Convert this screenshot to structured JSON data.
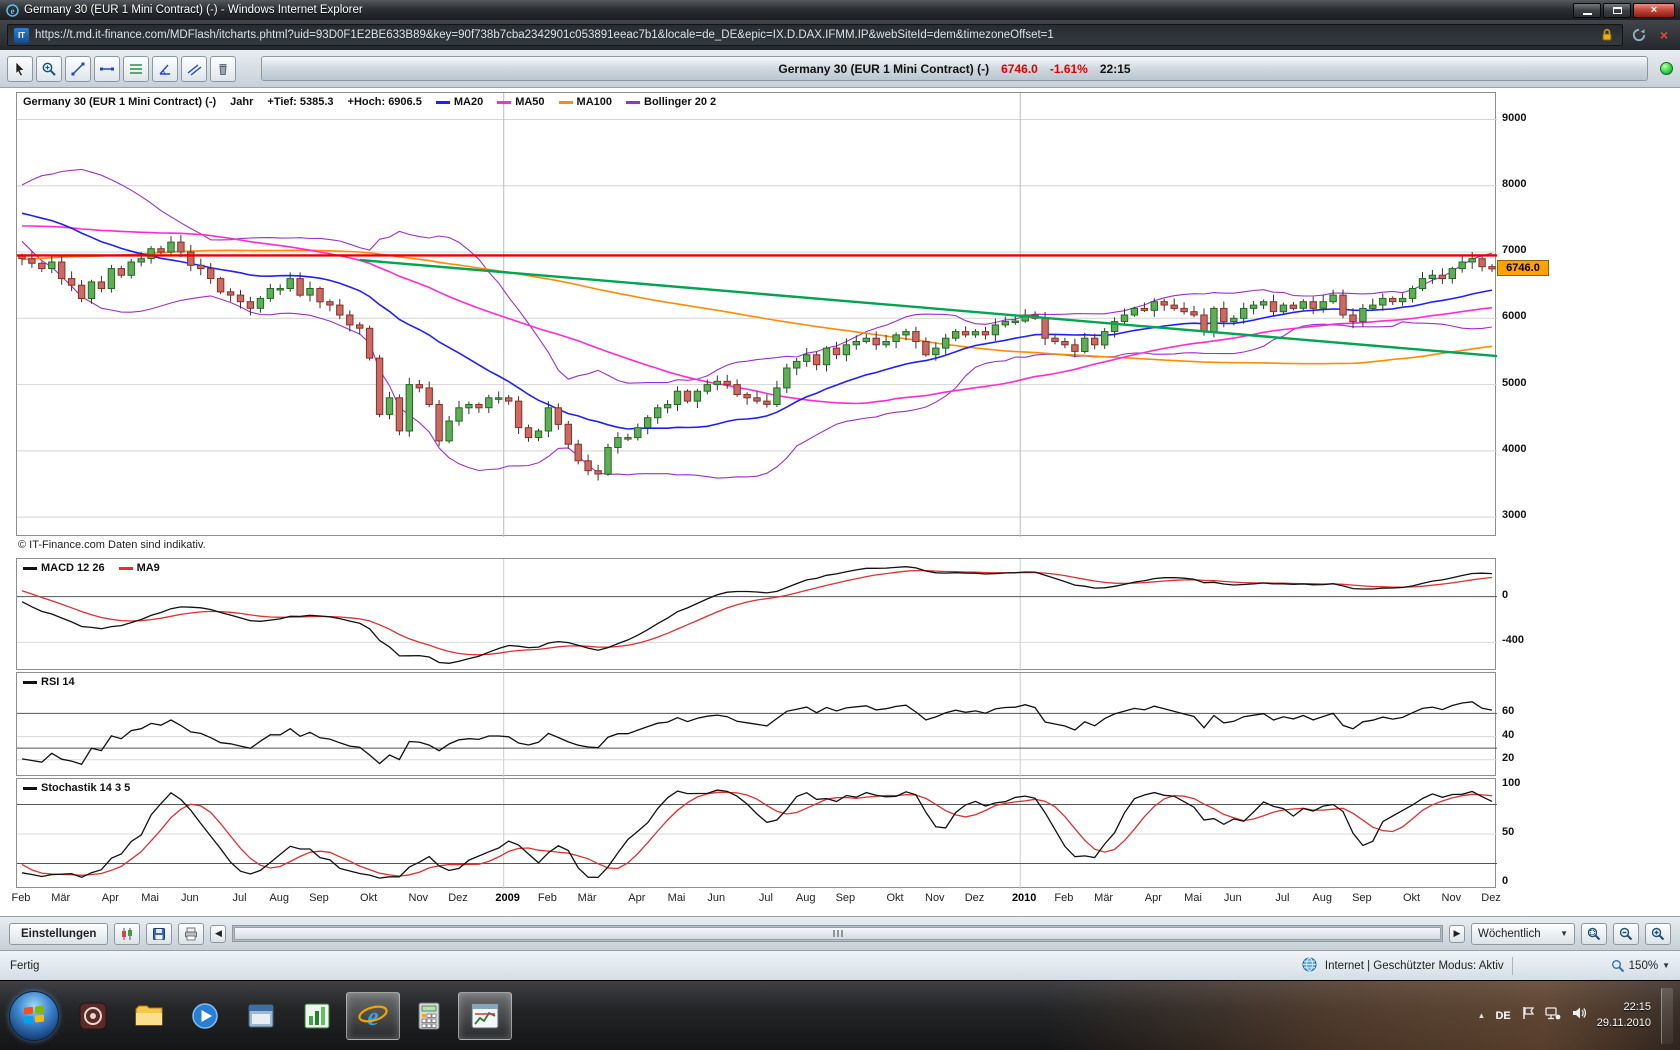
{
  "window": {
    "title": "Germany 30 (EUR 1 Mini Contract) (-) - Windows Internet Explorer"
  },
  "address_bar": {
    "url": "https://t.md.it-finance.com/MDFlash/itcharts.phtml?uid=93D0F1E2BE633B89&key=90f738b7cba2342901c053891eeac7b1&locale=de_DE&epic=IX.D.DAX.IFMM.IP&webSiteId=dem&timezoneOffset=1"
  },
  "toolbar": {
    "tools": [
      "pointer",
      "zoom",
      "trendline",
      "horizontal-line",
      "fibonacci",
      "angle",
      "parallel-lines",
      "delete"
    ],
    "header": {
      "instrument": "Germany 30 (EUR 1 Mini Contract) (-)",
      "price": "6746.0",
      "change": "-1.61%",
      "time": "22:15"
    }
  },
  "chart_data": {
    "type": "candlestick",
    "title": "Germany 30 (EUR 1 Mini Contract) (-)",
    "period_label": "Jahr",
    "low_label": "+Tief: 5385.3",
    "high_label": "+Hoch: 6906.5",
    "last_price": "6746.0",
    "copyright": "© IT-Finance.com Daten sind indikativ.",
    "y_ticks": [
      9000,
      8000,
      7000,
      6000,
      5000,
      4000,
      3000
    ],
    "y_range": [
      2700,
      9400
    ],
    "first_open": 6950,
    "closes": [
      6900,
      6830,
      6750,
      6850,
      6600,
      6500,
      6300,
      6550,
      6450,
      6750,
      6650,
      6850,
      6900,
      7050,
      7000,
      7150,
      7000,
      6800,
      6750,
      6600,
      6400,
      6350,
      6250,
      6150,
      6300,
      6450,
      6450,
      6600,
      6350,
      6450,
      6250,
      6200,
      6050,
      5900,
      5850,
      5400,
      4550,
      4800,
      4300,
      5000,
      4950,
      4700,
      4150,
      4450,
      4650,
      4700,
      4650,
      4800,
      4800,
      4750,
      4350,
      4200,
      4300,
      4650,
      4400,
      4100,
      3850,
      3700,
      3650,
      4050,
      4200,
      4200,
      4350,
      4500,
      4650,
      4700,
      4900,
      4750,
      4900,
      5000,
      5050,
      5000,
      4850,
      4800,
      4750,
      4700,
      4950,
      5250,
      5350,
      5450,
      5300,
      5550,
      5450,
      5600,
      5650,
      5700,
      5600,
      5650,
      5750,
      5800,
      5650,
      5450,
      5550,
      5700,
      5800,
      5750,
      5800,
      5750,
      5900,
      5950,
      5960,
      6050,
      6000,
      5700,
      5650,
      5600,
      5500,
      5700,
      5600,
      5800,
      5950,
      6050,
      6150,
      6120,
      6250,
      6200,
      6150,
      6100,
      6050,
      5800,
      6150,
      5950,
      6000,
      6150,
      6200,
      6250,
      6100,
      6200,
      6150,
      6250,
      6150,
      6250,
      6350,
      6050,
      5950,
      6150,
      6200,
      6300,
      6250,
      6300,
      6450,
      6600,
      6650,
      6600,
      6750,
      6850,
      6900,
      6780,
      6746
    ],
    "month_ticks": [
      {
        "label": "Feb",
        "week": 0
      },
      {
        "label": "Mär",
        "week": 4
      },
      {
        "label": "Apr",
        "week": 9
      },
      {
        "label": "Mai",
        "week": 13
      },
      {
        "label": "Jun",
        "week": 17
      },
      {
        "label": "Jul",
        "week": 22
      },
      {
        "label": "Aug",
        "week": 26
      },
      {
        "label": "Sep",
        "week": 30
      },
      {
        "label": "Okt",
        "week": 35
      },
      {
        "label": "Nov",
        "week": 40
      },
      {
        "label": "Dez",
        "week": 44
      },
      {
        "label": "2009",
        "week": 49
      },
      {
        "label": "Feb",
        "week": 53
      },
      {
        "label": "Mär",
        "week": 57
      },
      {
        "label": "Apr",
        "week": 62
      },
      {
        "label": "Mai",
        "week": 66
      },
      {
        "label": "Jun",
        "week": 70
      },
      {
        "label": "Jul",
        "week": 75
      },
      {
        "label": "Aug",
        "week": 79
      },
      {
        "label": "Sep",
        "week": 83
      },
      {
        "label": "Okt",
        "week": 88
      },
      {
        "label": "Nov",
        "week": 92
      },
      {
        "label": "Dez",
        "week": 96
      },
      {
        "label": "2010",
        "week": 101
      },
      {
        "label": "Feb",
        "week": 105
      },
      {
        "label": "Mär",
        "week": 109
      },
      {
        "label": "Apr",
        "week": 114
      },
      {
        "label": "Mai",
        "week": 118
      },
      {
        "label": "Jun",
        "week": 122
      },
      {
        "label": "Jul",
        "week": 127
      },
      {
        "label": "Aug",
        "week": 131
      },
      {
        "label": "Sep",
        "week": 135
      },
      {
        "label": "Okt",
        "week": 140
      },
      {
        "label": "Nov",
        "week": 144
      },
      {
        "label": "Dez",
        "week": 148
      }
    ],
    "year_lines": [
      49,
      101
    ],
    "overlays": [
      {
        "label": "MA20",
        "color": "#1f1fff",
        "period": 20
      },
      {
        "label": "MA50",
        "color": "#ff2ad4",
        "period": 50
      },
      {
        "label": "MA100",
        "color": "#ff8c00",
        "period": 100
      },
      {
        "label": "Bollinger 20 2",
        "color": "#9b30d0",
        "period": 20,
        "stdev": 2
      }
    ],
    "annotations": {
      "resistance_price": 6950,
      "resistance_color": "#e60000",
      "trendline": {
        "from_week": 34,
        "from_price": 6880,
        "to_price": 5430,
        "color": "#00a550"
      }
    },
    "panels": {
      "macd": {
        "label": "MACD 12 26",
        "signal_label": "MA9",
        "fast": 12,
        "slow": 26,
        "signal": 9,
        "ticks": [
          0,
          -400
        ],
        "line_color": "#111111",
        "signal_color": "#e03030"
      },
      "rsi": {
        "label": "RSI 14",
        "period": 14,
        "ticks": [
          60,
          40,
          20
        ],
        "range": [
          5,
          95
        ],
        "line_color": "#111111"
      },
      "stoch": {
        "label": "Stochastik 14 3 5",
        "k": 14,
        "k_smooth": 3,
        "d": 5,
        "ticks": [
          100,
          50,
          0
        ],
        "range": [
          -6,
          106
        ],
        "k_color": "#111111",
        "d_color": "#e03030"
      }
    }
  },
  "bottom_toolbar": {
    "settings_label": "Einstellungen",
    "period_label": "Wöchentlich",
    "icons": [
      "chart-type",
      "save",
      "print"
    ],
    "zoom_icons": [
      "zoom-range",
      "zoom-out",
      "zoom-in"
    ]
  },
  "status_bar": {
    "state": "Fertig",
    "zone": "Internet | Geschützter Modus: Aktiv",
    "zoom": "150%"
  },
  "taskbar": {
    "language": "DE",
    "clock_time": "22:15",
    "clock_date": "29.11.2010",
    "apps": [
      {
        "name": "media-center",
        "active": false
      },
      {
        "name": "windows-explorer",
        "active": false
      },
      {
        "name": "media-player",
        "active": false
      },
      {
        "name": "app-window",
        "active": false
      },
      {
        "name": "chart-app",
        "active": false
      },
      {
        "name": "internet-explorer",
        "active": true
      },
      {
        "name": "calculator",
        "active": false
      },
      {
        "name": "chart-window",
        "active": true
      }
    ]
  }
}
